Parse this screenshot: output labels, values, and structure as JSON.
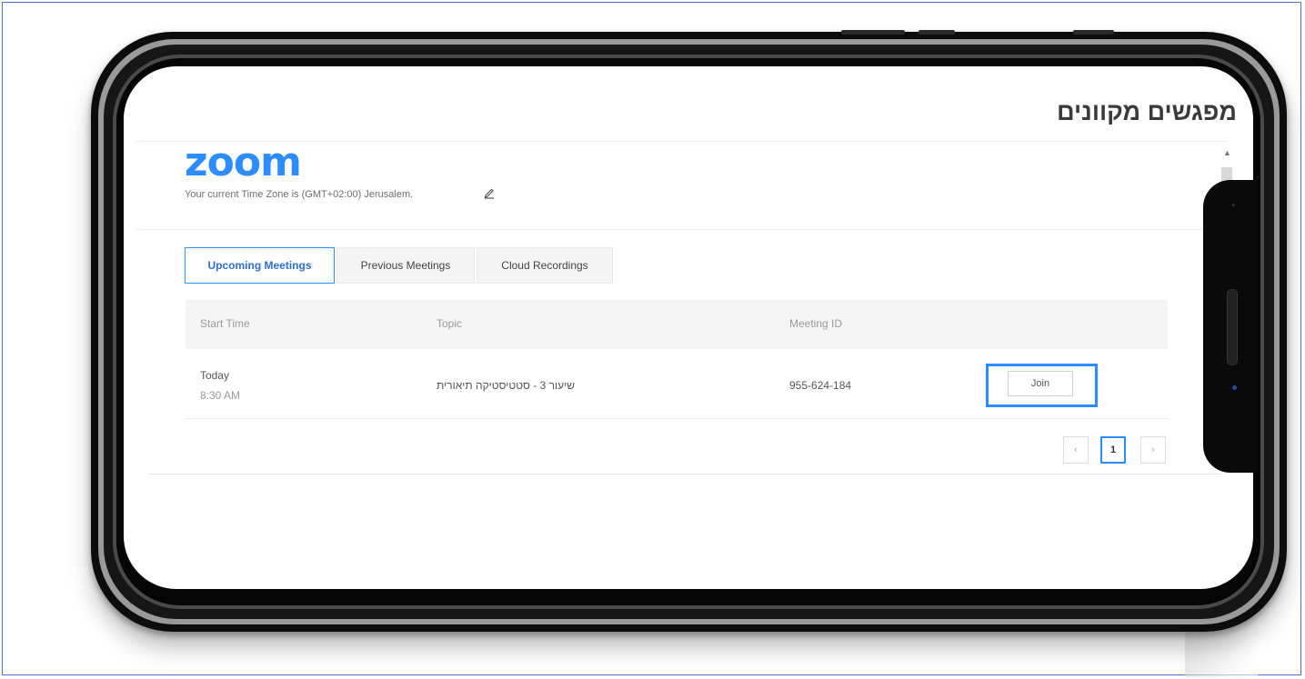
{
  "page": {
    "title": "מפגשים מקוונים"
  },
  "zoom": {
    "logo": "zoom",
    "timezone_text": "Your current Time Zone is (GMT+02:00) Jerusalem."
  },
  "tabs": [
    {
      "label": "Upcoming Meetings",
      "active": true
    },
    {
      "label": "Previous Meetings",
      "active": false
    },
    {
      "label": "Cloud Recordings",
      "active": false
    }
  ],
  "table": {
    "headers": {
      "start_time": "Start Time",
      "topic": "Topic",
      "meeting_id": "Meeting ID"
    },
    "rows": [
      {
        "day": "Today",
        "time": "8:30 AM",
        "topic": "שיעור 3 - סטטיסטיקה תיאורית",
        "meeting_id": "955-624-184",
        "action": "Join"
      }
    ]
  },
  "pagination": {
    "prev": "‹",
    "current": "1",
    "next": "›"
  },
  "colors": {
    "accent": "#2d8cff",
    "title": "#3a3a3a"
  }
}
